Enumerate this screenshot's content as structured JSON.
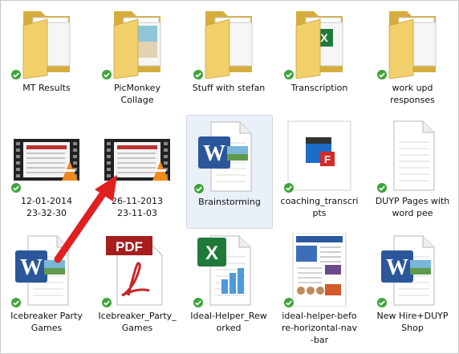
{
  "items": [
    {
      "label": "MT Results",
      "icon": "folder-icon",
      "type": "folder"
    },
    {
      "label": "PicMonkey\nCollage",
      "icon": "folder-icon",
      "type": "folder-photo"
    },
    {
      "label": "Stuff with stefan",
      "icon": "folder-icon",
      "type": "folder"
    },
    {
      "label": "Transcription",
      "icon": "folder-icon",
      "type": "folder-excel"
    },
    {
      "label": "work upd\nresponses",
      "icon": "folder-icon",
      "type": "folder"
    },
    {
      "label": "12-01-2014\n23-32-30",
      "icon": "video-thumbnail-icon",
      "type": "video"
    },
    {
      "label": "26-11-2013\n23-11-03",
      "icon": "video-thumbnail-icon",
      "type": "video"
    },
    {
      "label": "Brainstorming",
      "icon": "word-document-icon",
      "type": "word",
      "selected": true
    },
    {
      "label": "coaching_transcri\npts",
      "icon": "flash-video-icon",
      "type": "flash"
    },
    {
      "label": "DUYP Pages with\nword pee",
      "icon": "text-document-icon",
      "type": "text"
    },
    {
      "label": "Icebreaker Party\nGames",
      "icon": "word-document-icon",
      "type": "word"
    },
    {
      "label": "Icebreaker_Party_\nGames",
      "icon": "pdf-document-icon",
      "type": "pdf"
    },
    {
      "label": "Ideal-Helper_Rew\norked",
      "icon": "excel-document-icon",
      "type": "excel"
    },
    {
      "label": "ideal-helper-befo\nre-horizontal-nav\n-bar",
      "icon": "webpage-thumbnail-icon",
      "type": "web"
    },
    {
      "label": "New Hire+DUYP\nShop",
      "icon": "word-document-icon",
      "type": "word"
    }
  ],
  "pdf_badge": "PDF",
  "colors": {
    "folder": "#f1cf6b",
    "folder_dark": "#d6ad3d",
    "sync_check": "#3ea43a",
    "arrow": "#e02020",
    "word_blue": "#2b579a",
    "excel_green": "#1f7a3a"
  }
}
